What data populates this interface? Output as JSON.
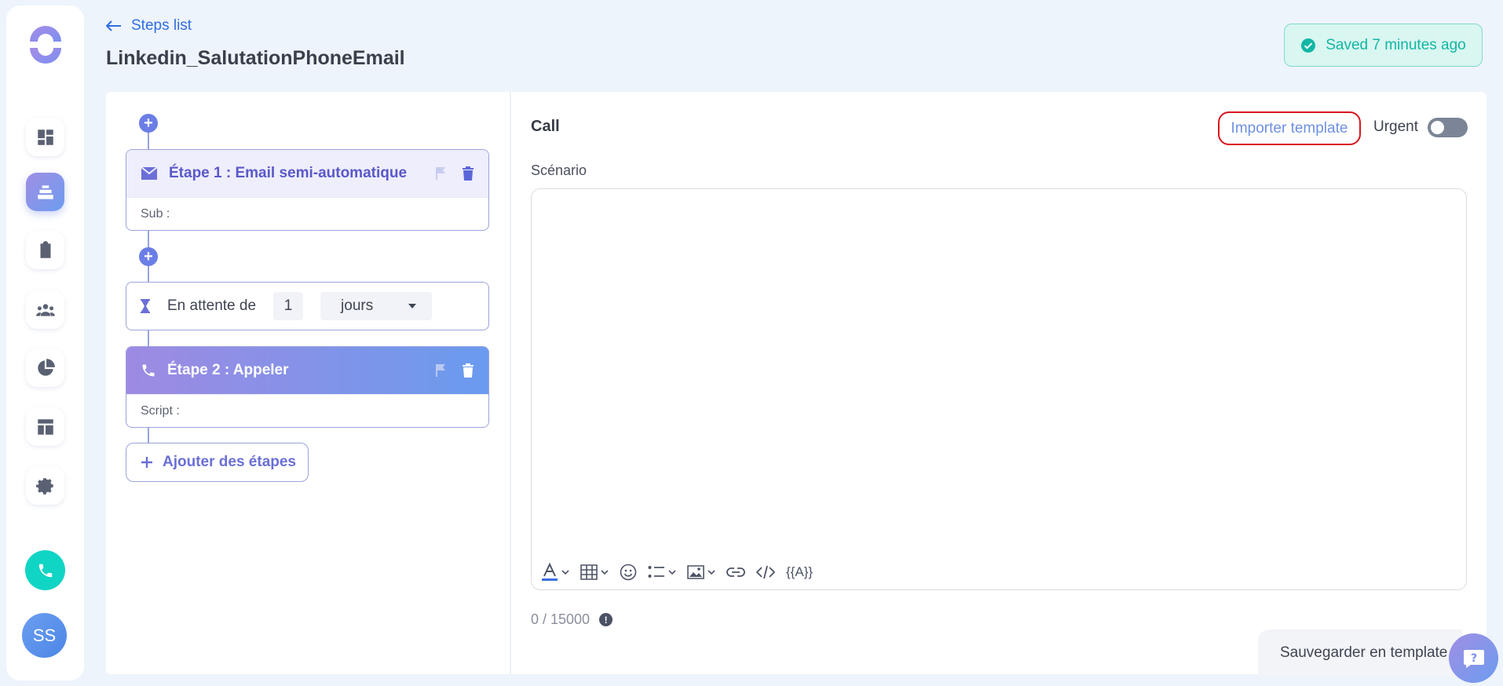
{
  "header": {
    "back_label": "Steps list",
    "title": "Linkedin_SalutationPhoneEmail",
    "saved_status": "Saved 7 minutes ago"
  },
  "sidebar": {
    "items": [
      {
        "name": "dashboard-icon",
        "active": false
      },
      {
        "name": "sequences-icon",
        "active": true
      },
      {
        "name": "tasks-icon",
        "active": false
      },
      {
        "name": "contacts-icon",
        "active": false
      },
      {
        "name": "reports-icon",
        "active": false
      },
      {
        "name": "templates-icon",
        "active": false
      },
      {
        "name": "settings-icon",
        "active": false
      }
    ],
    "avatar_initials": "SS"
  },
  "steps": {
    "step1": {
      "title": "Étape 1 : Email semi-automatique",
      "sub": "Sub :"
    },
    "wait": {
      "prefix": "En attente de",
      "value": "1",
      "unit": "jours"
    },
    "step2": {
      "title": "Étape 2 : Appeler",
      "sub": "Script :"
    },
    "add_label": "Ajouter des étapes"
  },
  "panel": {
    "title": "Call",
    "import_label": "Importer template",
    "urgent_label": "Urgent",
    "urgent_on": false,
    "field_label": "Scénario",
    "editor_value": "",
    "variable_label": "{{A}}",
    "counter": "0 / 15000",
    "save_template_label": "Sauvegarder en template"
  },
  "colors": {
    "accent": "#6b7ee6",
    "success": "#12b7a3",
    "highlight_border": "#d8161f"
  }
}
